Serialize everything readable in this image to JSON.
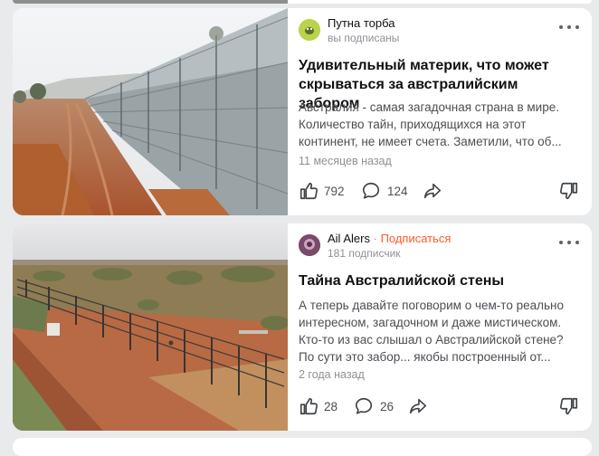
{
  "feed": {
    "cards": [
      {
        "channel": {
          "name": "Путна торба",
          "subtitle": "вы подписаны"
        },
        "title": "Удивительный материк, что может скрываться за австралийским забором",
        "snippet_lines": [
          "Австралия - самая загадочная страна в мире.",
          "Количество тайн, приходящихся на этот",
          "континент, не имеет счета. Заметили, что об..."
        ],
        "age": "11 месяцев назад",
        "likes": "792",
        "comments": "124",
        "colors": {
          "avatar_bg": "#b9d34a"
        }
      },
      {
        "channel": {
          "name": "Ail Alers",
          "separator": "·",
          "subscribe": "Подписаться",
          "subtitle": "181 подписчик"
        },
        "title": "Тайна Австралийской стены",
        "snippet_lines": [
          "А теперь давайте поговорим о чем-то реально",
          "интересном, загадочном и даже мистическом.",
          "Кто-то из вас слышал о Австралийской стене?",
          "По сути это забор... якобы построенный от..."
        ],
        "age": "2 года назад",
        "likes": "28",
        "comments": "26",
        "colors": {
          "avatar_bg": "#7a4a6a"
        }
      }
    ]
  },
  "icons": [
    "like-icon",
    "comment-icon",
    "share-icon",
    "dislike-icon",
    "more-icon"
  ],
  "colors": {
    "page_bg": "#e9eaec",
    "subscribe": "#ff5a26",
    "muted": "#8e9196"
  }
}
